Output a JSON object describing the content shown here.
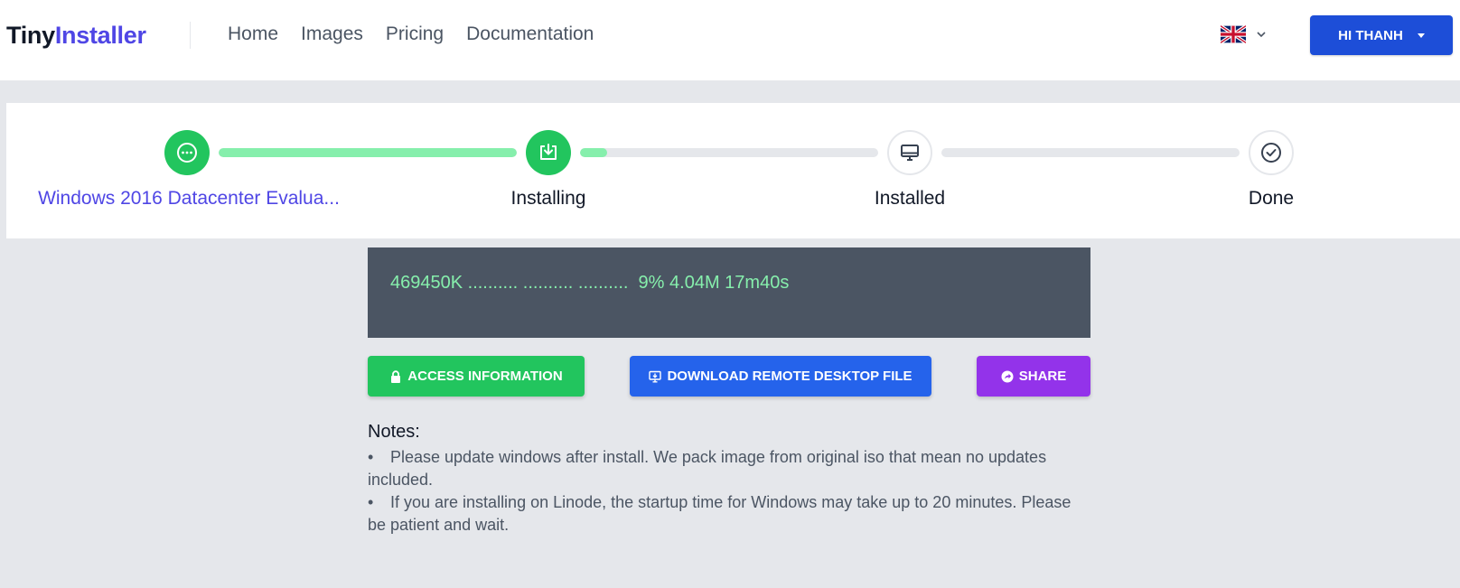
{
  "header": {
    "logo_part1": "Tiny",
    "logo_part2": "Installer",
    "nav": [
      "Home",
      "Images",
      "Pricing",
      "Documentation"
    ],
    "language_icon": "uk-flag-icon",
    "user_button": "HI THANH"
  },
  "stepper": {
    "steps": [
      {
        "label": "Windows 2016 Datacenter Evalua...",
        "status": "done",
        "icon": "ellipsis-circle-icon"
      },
      {
        "label": "Installing",
        "status": "done",
        "icon": "download-tray-icon"
      },
      {
        "label": "Installed",
        "status": "pending",
        "icon": "monitor-icon"
      },
      {
        "label": "Done",
        "status": "pending",
        "icon": "check-circle-icon"
      }
    ],
    "connector_progress": [
      1.0,
      0.09,
      0.0
    ],
    "colors": {
      "done": "#22c55e",
      "progress": "#86efac",
      "track": "#e5e7eb",
      "link": "#4f46e5"
    }
  },
  "console": {
    "text": "469450K .......... .......... ..........  9% 4.04M 17m40s"
  },
  "actions": {
    "access": "ACCESS INFORMATION",
    "rdp": "DOWNLOAD REMOTE DESKTOP FILE",
    "share": "SHARE"
  },
  "notes": {
    "title": "Notes:",
    "items": [
      "Please update windows after install. We pack image from original iso that mean no updates included.",
      "If you are installing on Linode, the startup time for Windows may take up to 20 minutes. Please be patient and wait."
    ]
  }
}
